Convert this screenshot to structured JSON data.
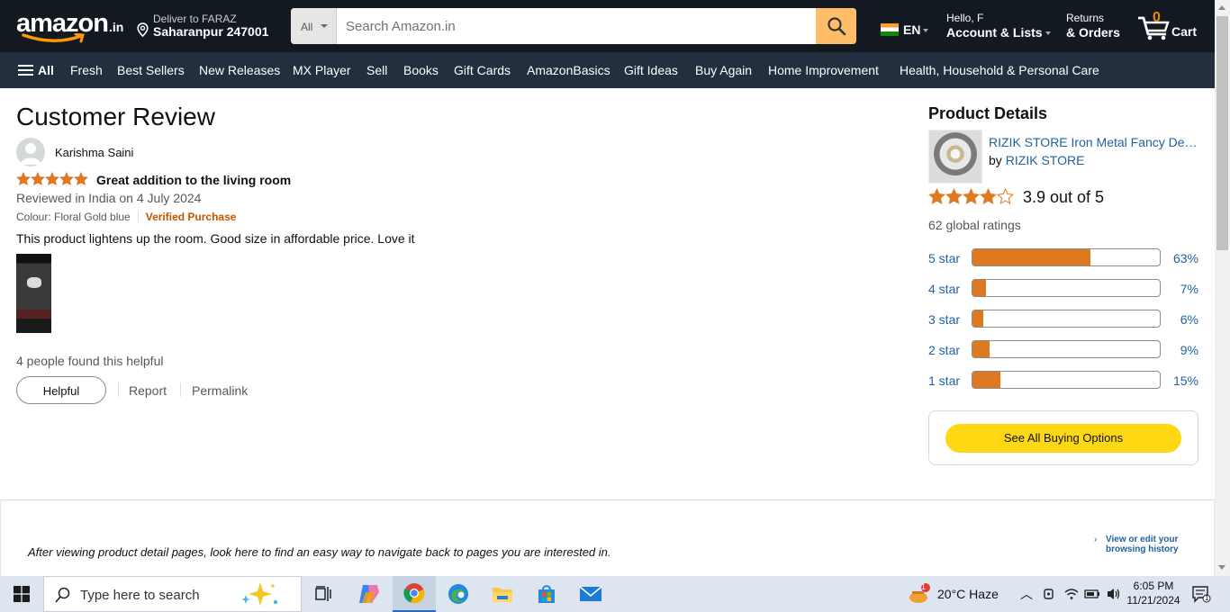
{
  "header": {
    "logo_text": "amazon",
    "logo_tld": ".in",
    "deliver_line1": "Deliver to FARAZ",
    "deliver_line2": "Saharanpur 247001",
    "search_category": "All",
    "search_placeholder": "Search Amazon.in",
    "language": "EN",
    "account_line1": "Hello, F",
    "account_line2": "Account & Lists",
    "returns_line1": "Returns",
    "returns_line2": "& Orders",
    "cart_count": "0",
    "cart_label": "Cart"
  },
  "navbar": {
    "all_label": "All",
    "items": [
      "Fresh",
      "Best Sellers",
      "New Releases",
      "MX Player",
      "Sell",
      "Books",
      "Gift Cards",
      "AmazonBasics",
      "Gift Ideas",
      "Buy Again",
      "Home Improvement",
      "Health, Household & Personal Care"
    ]
  },
  "review": {
    "page_title": "Customer Review",
    "reviewer": "Karishma Saini",
    "stars": 5,
    "title": "Great addition to the living room",
    "date": "Reviewed in India on 4 July 2024",
    "colour": "Colour: Floral Gold blue",
    "verified": "Verified Purchase",
    "body": "This product lightens up the room. Good size in affordable price. Love it",
    "helpful_count_text": "4 people found this helpful",
    "helpful_button": "Helpful",
    "report": "Report",
    "permalink": "Permalink"
  },
  "product": {
    "section_title": "Product Details",
    "name": "RIZIK STORE Iron Metal Fancy Decorative Wall Art",
    "by_label": "by",
    "brand": "RIZIK STORE",
    "rating_value": 3.9,
    "rating_text": "3.9 out of 5",
    "global_ratings": "62 global ratings",
    "histogram": [
      {
        "label": "5 star",
        "percent": 63,
        "percent_text": "63%"
      },
      {
        "label": "4 star",
        "percent": 7,
        "percent_text": "7%"
      },
      {
        "label": "3 star",
        "percent": 6,
        "percent_text": "6%"
      },
      {
        "label": "2 star",
        "percent": 9,
        "percent_text": "9%"
      },
      {
        "label": "1 star",
        "percent": 15,
        "percent_text": "15%"
      }
    ],
    "buy_button": "See All Buying Options"
  },
  "footer": {
    "history_text": "After viewing product detail pages, look here to find an easy way to navigate back to pages you are interested in.",
    "view_history_link": "View or edit your browsing history"
  },
  "taskbar": {
    "search_placeholder": "Type here to search",
    "weather": "20°C  Haze",
    "weather_badge": "1",
    "time": "6:05 PM",
    "date": "11/21/2024",
    "notification_count": "1"
  },
  "colors": {
    "header_bg": "#131921",
    "navbar_bg": "#232f3e",
    "star": "#de7921",
    "link": "#2162a1",
    "buy_button": "#ffd814",
    "search_button": "#febd69",
    "verified": "#c45500"
  }
}
